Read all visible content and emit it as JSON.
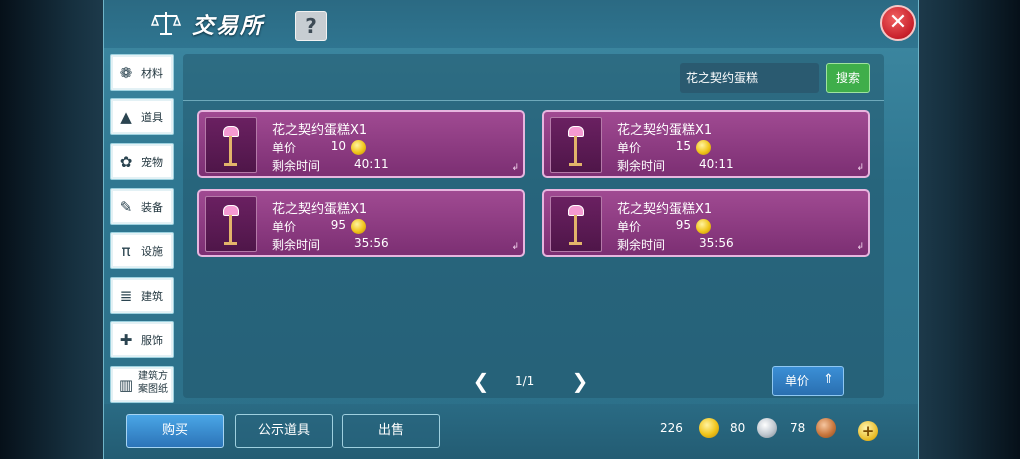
{
  "header": {
    "title": "交易所",
    "help_icon_label": "?",
    "close_icon_label": "✕"
  },
  "categories": [
    {
      "label": "材料",
      "icon": "materials-icon",
      "glyph": "❁"
    },
    {
      "label": "道具",
      "icon": "item-icon",
      "glyph": "▲"
    },
    {
      "label": "宠物",
      "icon": "pet-paw-icon",
      "glyph": "✿"
    },
    {
      "label": "装备",
      "icon": "equipment-icon",
      "glyph": "✎"
    },
    {
      "label": "设施",
      "icon": "facility-icon",
      "glyph": "π"
    },
    {
      "label": "建筑",
      "icon": "building-icon",
      "glyph": "≣"
    },
    {
      "label": "服饰",
      "icon": "clothing-icon",
      "glyph": "✚"
    },
    {
      "label": "建筑方案图纸",
      "icon": "blueprint-icon",
      "glyph": "▥"
    }
  ],
  "search": {
    "value": "花之契约蛋糕",
    "button_label": "搜索"
  },
  "listings": [
    {
      "name": "花之契约蛋糕X1",
      "price_label": "单价",
      "price": "10",
      "time_label": "剩余时间",
      "time": "40:11"
    },
    {
      "name": "花之契约蛋糕X1",
      "price_label": "单价",
      "price": "15",
      "time_label": "剩余时间",
      "time": "40:11"
    },
    {
      "name": "花之契约蛋糕X1",
      "price_label": "单价",
      "price": "95",
      "time_label": "剩余时间",
      "time": "35:56"
    },
    {
      "name": "花之契约蛋糕X1",
      "price_label": "单价",
      "price": "95",
      "time_label": "剩余时间",
      "time": "35:56"
    }
  ],
  "pagination": {
    "text": "1/1",
    "prev": "❮",
    "next": "❯"
  },
  "sort": {
    "label": "单价",
    "arrow": "⇑"
  },
  "bottom_tabs": {
    "buy": "购买",
    "public": "公示道具",
    "sell": "出售"
  },
  "currency": {
    "gold": "226",
    "silver": "80",
    "bronze": "78",
    "add": "+"
  },
  "colors": {
    "card_bg": "#8a3880",
    "search_button": "#3fae4a",
    "buy_button": "#2c74b8",
    "close_button": "#c81f2a"
  }
}
